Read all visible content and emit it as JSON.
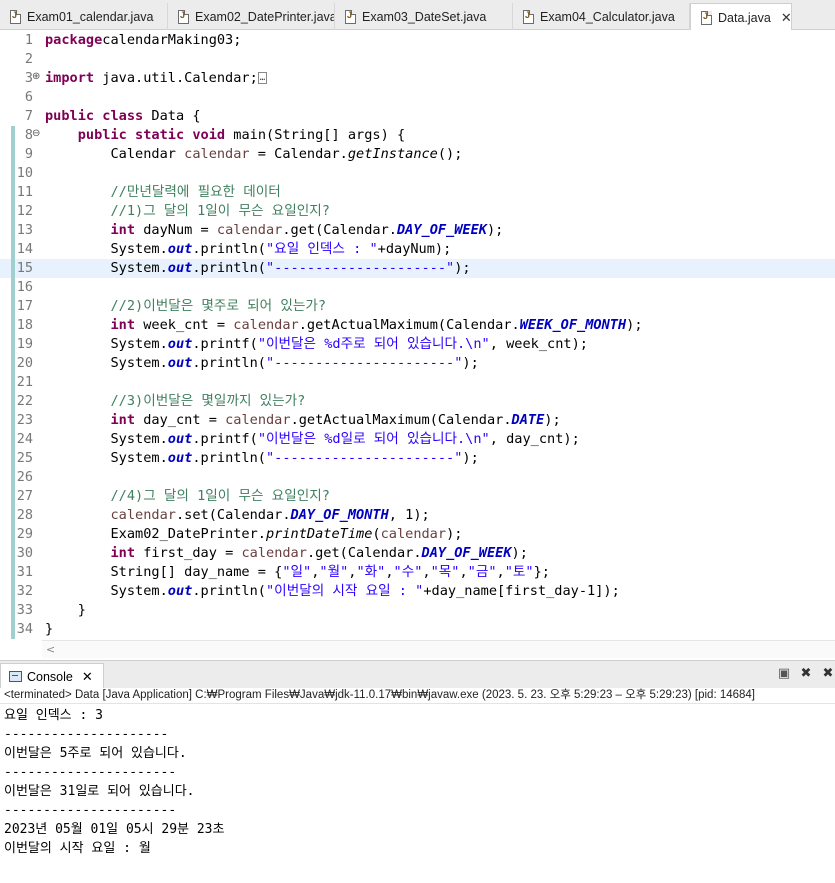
{
  "tabs": [
    {
      "label": "Exam01_calendar.java",
      "active": false
    },
    {
      "label": "Exam02_DatePrinter.java",
      "active": false
    },
    {
      "label": "Exam03_DateSet.java",
      "active": false
    },
    {
      "label": "Exam04_Calculator.java",
      "active": false
    },
    {
      "label": "Data.java",
      "active": true
    }
  ],
  "tab_close_glyph": "✕",
  "editor": {
    "current_line": 15,
    "changed_line_range": [
      8,
      34
    ],
    "lines": [
      {
        "n": "1",
        "tokens": [
          [
            "kw",
            "package"
          ],
          [
            "",
            "calendarMaking03;"
          ]
        ]
      },
      {
        "n": "2",
        "tokens": []
      },
      {
        "n": "3",
        "fold": "⊕",
        "tokens": [
          [
            "kw",
            "import"
          ],
          [
            "",
            " java.util.Calendar;"
          ],
          [
            "ellip",
            "…"
          ]
        ]
      },
      {
        "n": "6",
        "tokens": []
      },
      {
        "n": "7",
        "tokens": [
          [
            "kw",
            "public"
          ],
          [
            "",
            " "
          ],
          [
            "kw",
            "class"
          ],
          [
            "",
            " Data {"
          ]
        ]
      },
      {
        "n": "8",
        "fold": "⊖",
        "tokens": [
          [
            "",
            "    "
          ],
          [
            "kw",
            "public"
          ],
          [
            "",
            " "
          ],
          [
            "kw",
            "static"
          ],
          [
            "",
            " "
          ],
          [
            "kw",
            "void"
          ],
          [
            "",
            " main(String[] args) {"
          ]
        ]
      },
      {
        "n": "9",
        "tokens": [
          [
            "",
            "        Calendar "
          ],
          [
            "lv",
            "calendar"
          ],
          [
            "",
            " = Calendar."
          ],
          [
            "sm",
            "getInstance"
          ],
          [
            "",
            "();"
          ]
        ]
      },
      {
        "n": "10",
        "tokens": []
      },
      {
        "n": "11",
        "tokens": [
          [
            "",
            "        "
          ],
          [
            "cm",
            "//만년달력에 필요한 데이터"
          ]
        ]
      },
      {
        "n": "12",
        "tokens": [
          [
            "",
            "        "
          ],
          [
            "cm",
            "//1)그 달의 1일이 무슨 요일인지?"
          ]
        ]
      },
      {
        "n": "13",
        "tokens": [
          [
            "",
            "        "
          ],
          [
            "kw",
            "int"
          ],
          [
            "",
            " dayNum = "
          ],
          [
            "lv",
            "calendar"
          ],
          [
            "",
            ".get(Calendar."
          ],
          [
            "fi",
            "DAY_OF_WEEK"
          ],
          [
            "",
            ");"
          ]
        ]
      },
      {
        "n": "14",
        "tokens": [
          [
            "",
            "        System."
          ],
          [
            "fi",
            "out"
          ],
          [
            "",
            ".println("
          ],
          [
            "st",
            "\"요일 인덱스 : \""
          ],
          [
            "",
            "+dayNum);"
          ]
        ]
      },
      {
        "n": "15",
        "tokens": [
          [
            "",
            "        System."
          ],
          [
            "fi",
            "out"
          ],
          [
            "",
            ".println("
          ],
          [
            "st",
            "\"---------------------\""
          ],
          [
            "",
            ");"
          ]
        ]
      },
      {
        "n": "16",
        "tokens": []
      },
      {
        "n": "17",
        "tokens": [
          [
            "",
            "        "
          ],
          [
            "cm",
            "//2)이번달은 몇주로 되어 있는가?"
          ]
        ]
      },
      {
        "n": "18",
        "tokens": [
          [
            "",
            "        "
          ],
          [
            "kw",
            "int"
          ],
          [
            "",
            " week_cnt = "
          ],
          [
            "lv",
            "calendar"
          ],
          [
            "",
            ".getActualMaximum(Calendar."
          ],
          [
            "fi",
            "WEEK_OF_MONTH"
          ],
          [
            "",
            ");"
          ]
        ]
      },
      {
        "n": "19",
        "tokens": [
          [
            "",
            "        System."
          ],
          [
            "fi",
            "out"
          ],
          [
            "",
            ".printf("
          ],
          [
            "st",
            "\"이번달은 %d주로 되어 있습니다.\\n\""
          ],
          [
            "",
            ", week_cnt);"
          ]
        ]
      },
      {
        "n": "20",
        "tokens": [
          [
            "",
            "        System."
          ],
          [
            "fi",
            "out"
          ],
          [
            "",
            ".println("
          ],
          [
            "st",
            "\"----------------------\""
          ],
          [
            "",
            ");"
          ]
        ]
      },
      {
        "n": "21",
        "tokens": []
      },
      {
        "n": "22",
        "tokens": [
          [
            "",
            "        "
          ],
          [
            "cm",
            "//3)이번달은 몇일까지 있는가?"
          ]
        ]
      },
      {
        "n": "23",
        "tokens": [
          [
            "",
            "        "
          ],
          [
            "kw",
            "int"
          ],
          [
            "",
            " day_cnt = "
          ],
          [
            "lv",
            "calendar"
          ],
          [
            "",
            ".getActualMaximum(Calendar."
          ],
          [
            "fi",
            "DATE"
          ],
          [
            "",
            ");"
          ]
        ]
      },
      {
        "n": "24",
        "tokens": [
          [
            "",
            "        System."
          ],
          [
            "fi",
            "out"
          ],
          [
            "",
            ".printf("
          ],
          [
            "st",
            "\"이번달은 %d일로 되어 있습니다.\\n\""
          ],
          [
            "",
            ", day_cnt);"
          ]
        ]
      },
      {
        "n": "25",
        "tokens": [
          [
            "",
            "        System."
          ],
          [
            "fi",
            "out"
          ],
          [
            "",
            ".println("
          ],
          [
            "st",
            "\"----------------------\""
          ],
          [
            "",
            ");"
          ]
        ]
      },
      {
        "n": "26",
        "tokens": []
      },
      {
        "n": "27",
        "tokens": [
          [
            "",
            "        "
          ],
          [
            "cm",
            "//4)그 달의 1일이 무슨 요일인지?"
          ]
        ]
      },
      {
        "n": "28",
        "tokens": [
          [
            "",
            "        "
          ],
          [
            "lv",
            "calendar"
          ],
          [
            "",
            ".set(Calendar."
          ],
          [
            "fi",
            "DAY_OF_MONTH"
          ],
          [
            "",
            ", 1);"
          ]
        ]
      },
      {
        "n": "29",
        "tokens": [
          [
            "",
            "        Exam02_DatePrinter."
          ],
          [
            "sm",
            "printDateTime"
          ],
          [
            "",
            "("
          ],
          [
            "lv",
            "calendar"
          ],
          [
            "",
            ");"
          ]
        ]
      },
      {
        "n": "30",
        "tokens": [
          [
            "",
            "        "
          ],
          [
            "kw",
            "int"
          ],
          [
            "",
            " first_day = "
          ],
          [
            "lv",
            "calendar"
          ],
          [
            "",
            ".get(Calendar."
          ],
          [
            "fi",
            "DAY_OF_WEEK"
          ],
          [
            "",
            ");"
          ]
        ]
      },
      {
        "n": "31",
        "tokens": [
          [
            "",
            "        String[] day_name = {"
          ],
          [
            "st",
            "\"일\""
          ],
          [
            "",
            ","
          ],
          [
            "st",
            "\"월\""
          ],
          [
            "",
            ","
          ],
          [
            "st",
            "\"화\""
          ],
          [
            "",
            ","
          ],
          [
            "st",
            "\"수\""
          ],
          [
            "",
            ","
          ],
          [
            "st",
            "\"목\""
          ],
          [
            "",
            ","
          ],
          [
            "st",
            "\"금\""
          ],
          [
            "",
            ","
          ],
          [
            "st",
            "\"토\""
          ],
          [
            "",
            "};"
          ]
        ]
      },
      {
        "n": "32",
        "tokens": [
          [
            "",
            "        System."
          ],
          [
            "fi",
            "out"
          ],
          [
            "",
            ".println("
          ],
          [
            "st",
            "\"이번달의 시작 요일 : \""
          ],
          [
            "",
            "+day_name[first_day-1]);"
          ]
        ]
      },
      {
        "n": "33",
        "tokens": [
          [
            "",
            "    }"
          ]
        ]
      },
      {
        "n": "34",
        "tokens": [
          [
            "",
            "}"
          ]
        ]
      }
    ]
  },
  "hscroll_arrow": "<",
  "console": {
    "tab_label": "Console",
    "close_glyph": "✕",
    "toolbar_icons": [
      "stop-icon",
      "remove-launch-icon",
      "remove-all-icon"
    ],
    "status": "<terminated> Data [Java Application] C:₩Program Files₩Java₩jdk-11.0.17₩bin₩javaw.exe  (2023. 5. 23. 오후 5:29:23 – 오후 5:29:23) [pid: 14684]",
    "output": [
      "요일 인덱스 : 3",
      "---------------------",
      "이번달은 5주로 되어 있습니다.",
      "----------------------",
      "이번달은 31일로 되어 있습니다.",
      "----------------------",
      "2023년 05월 01일 05시 29분 23초",
      "이번달의 시작 요일 : 월"
    ]
  }
}
